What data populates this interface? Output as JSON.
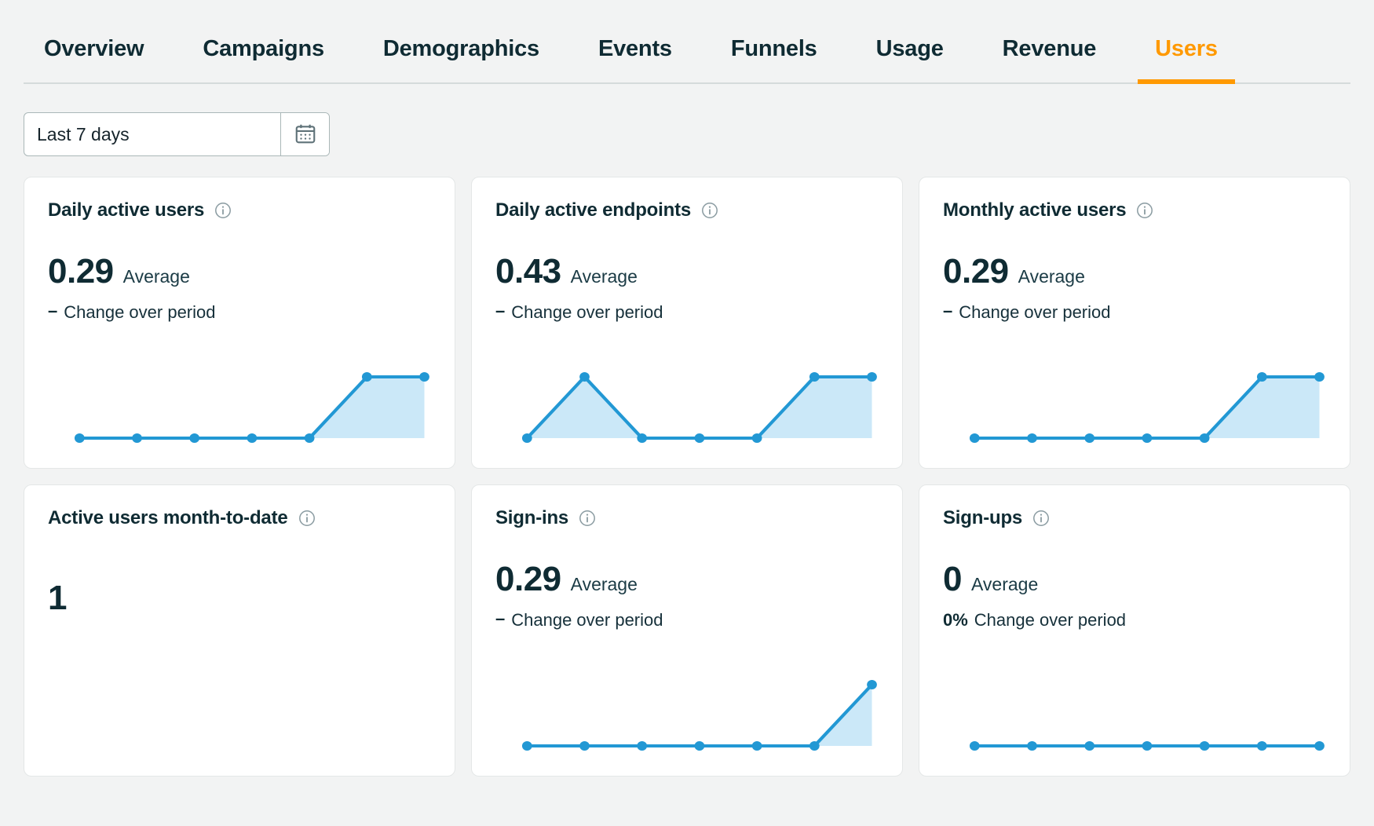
{
  "nav": {
    "tabs": [
      {
        "label": "Overview",
        "active": false
      },
      {
        "label": "Campaigns",
        "active": false
      },
      {
        "label": "Demographics",
        "active": false
      },
      {
        "label": "Events",
        "active": false
      },
      {
        "label": "Funnels",
        "active": false
      },
      {
        "label": "Usage",
        "active": false
      },
      {
        "label": "Revenue",
        "active": false
      },
      {
        "label": "Users",
        "active": true
      }
    ],
    "active_color": "#ff9900",
    "text_color": "#0f2b33"
  },
  "filters": {
    "date_range_value": "Last 7 days",
    "date_range_placeholder": "Last 7 days",
    "calendar_icon": "calendar-icon"
  },
  "cards": [
    {
      "id": "daily-active-users",
      "title": "Daily active users",
      "info_icon": "info-icon",
      "value": "0.29",
      "unit": "Average",
      "change_delta": "–",
      "change_label": "Change over period",
      "has_chart": true
    },
    {
      "id": "daily-active-endpoints",
      "title": "Daily active endpoints",
      "info_icon": "info-icon",
      "value": "0.43",
      "unit": "Average",
      "change_delta": "–",
      "change_label": "Change over period",
      "has_chart": true
    },
    {
      "id": "monthly-active-users",
      "title": "Monthly active users",
      "info_icon": "info-icon",
      "value": "0.29",
      "unit": "Average",
      "change_delta": "–",
      "change_label": "Change over period",
      "has_chart": true
    },
    {
      "id": "active-users-month-to-date",
      "title": "Active users month-to-date",
      "info_icon": "info-icon",
      "value": "1",
      "unit": "",
      "change_delta": "",
      "change_label": "",
      "has_chart": false
    },
    {
      "id": "sign-ins",
      "title": "Sign-ins",
      "info_icon": "info-icon",
      "value": "0.29",
      "unit": "Average",
      "change_delta": "–",
      "change_label": "Change over period",
      "has_chart": true
    },
    {
      "id": "sign-ups",
      "title": "Sign-ups",
      "info_icon": "info-icon",
      "value": "0",
      "unit": "Average",
      "change_delta": "0%",
      "change_label": "Change over period",
      "has_chart": true
    }
  ],
  "chart_data": [
    {
      "type": "area",
      "title": "Daily active users",
      "x": [
        1,
        2,
        3,
        4,
        5,
        6,
        7
      ],
      "values": [
        0,
        0,
        0,
        0,
        0,
        1,
        1
      ],
      "ylim": [
        0,
        1
      ],
      "line_color": "#2298d4",
      "fill_color": "#cbe8f8",
      "point_color": "#2298d4",
      "grid": false,
      "legend": "none",
      "xlabel": "",
      "ylabel": ""
    },
    {
      "type": "area",
      "title": "Daily active endpoints",
      "x": [
        1,
        2,
        3,
        4,
        5,
        6,
        7
      ],
      "values": [
        0,
        1,
        0,
        0,
        0,
        1,
        1
      ],
      "ylim": [
        0,
        1
      ],
      "line_color": "#2298d4",
      "fill_color": "#cbe8f8",
      "point_color": "#2298d4",
      "grid": false,
      "legend": "none",
      "xlabel": "",
      "ylabel": ""
    },
    {
      "type": "area",
      "title": "Monthly active users",
      "x": [
        1,
        2,
        3,
        4,
        5,
        6,
        7
      ],
      "values": [
        0,
        0,
        0,
        0,
        0,
        1,
        1
      ],
      "ylim": [
        0,
        1
      ],
      "line_color": "#2298d4",
      "fill_color": "#cbe8f8",
      "point_color": "#2298d4",
      "grid": false,
      "legend": "none",
      "xlabel": "",
      "ylabel": ""
    },
    {
      "type": "area",
      "title": "Sign-ins",
      "x": [
        1,
        2,
        3,
        4,
        5,
        6,
        7
      ],
      "values": [
        0,
        0,
        0,
        0,
        0,
        0,
        1
      ],
      "ylim": [
        0,
        1
      ],
      "line_color": "#2298d4",
      "fill_color": "#cbe8f8",
      "point_color": "#2298d4",
      "grid": false,
      "legend": "none",
      "xlabel": "",
      "ylabel": ""
    },
    {
      "type": "area",
      "title": "Sign-ups",
      "x": [
        1,
        2,
        3,
        4,
        5,
        6,
        7
      ],
      "values": [
        0,
        0,
        0,
        0,
        0,
        0,
        0
      ],
      "ylim": [
        0,
        1
      ],
      "line_color": "#2298d4",
      "fill_color": "#cbe8f8",
      "point_color": "#2298d4",
      "grid": false,
      "legend": "none",
      "xlabel": "",
      "ylabel": ""
    }
  ]
}
